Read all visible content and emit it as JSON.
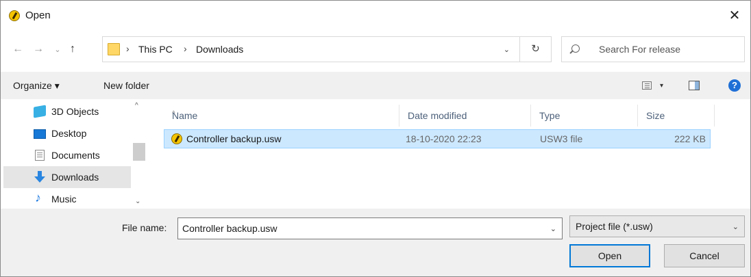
{
  "window": {
    "title": "Open",
    "close_glyph": "✕"
  },
  "nav": {
    "back": "←",
    "forward": "→",
    "recent": "⌄",
    "up": "↑",
    "breadcrumbs": [
      "This PC",
      "Downloads"
    ],
    "separator": "›",
    "address_dropdown": "⌄",
    "refresh": "↻",
    "search_placeholder": "Search For release"
  },
  "toolbar": {
    "organize": "Organize ▾",
    "new_folder": "New folder",
    "view_caret": "▾",
    "help": "?"
  },
  "sidebar": {
    "items": [
      {
        "label": "3D Objects",
        "icon": "3d-objects-icon"
      },
      {
        "label": "Desktop",
        "icon": "desktop-icon"
      },
      {
        "label": "Documents",
        "icon": "documents-icon"
      },
      {
        "label": "Downloads",
        "icon": "downloads-icon",
        "selected": true
      },
      {
        "label": "Music",
        "icon": "music-icon",
        "glyph": "♪"
      }
    ],
    "scroll_up": "^",
    "scroll_down": "⌄"
  },
  "files": {
    "sort_caret": "^",
    "columns": [
      "Name",
      "Date modified",
      "Type",
      "Size"
    ],
    "rows": [
      {
        "name": "Controller backup.usw",
        "date": "18-10-2020 22:23",
        "type": "USW3 file",
        "size": "222 KB"
      }
    ]
  },
  "bottom": {
    "file_name_label": "File name:",
    "file_name_value": "Controller backup.usw",
    "dropdown": "⌄",
    "filter_value": "Project file (*.usw)",
    "filter_caret": "⌄",
    "open_label": "Open",
    "cancel_label": "Cancel"
  },
  "colors": {
    "selection": "#cce8ff",
    "accent": "#0078d7",
    "toolbar_bg": "#f0f0f0"
  }
}
